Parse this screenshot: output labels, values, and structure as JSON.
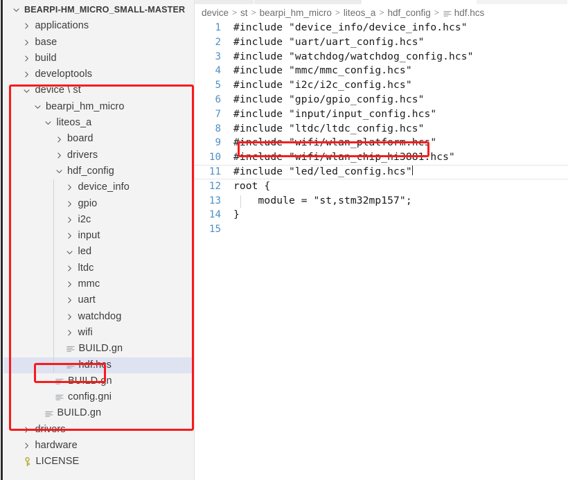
{
  "window": {
    "accent_red": "#f81b1b",
    "selection_bg": "#dfe2f1",
    "sidebar_bg": "#f3f3f3",
    "linenumber_color": "#4e8fc4"
  },
  "sidebar": {
    "root_label": "BEARPI-HM_MICRO_SMALL-MASTER",
    "items": [
      {
        "label": "BEARPI-HM_MICRO_SMALL-MASTER",
        "depth": 0,
        "kind": "folder",
        "state": "expanded",
        "root": true
      },
      {
        "label": "applications",
        "depth": 1,
        "kind": "folder",
        "state": "collapsed"
      },
      {
        "label": "base",
        "depth": 1,
        "kind": "folder",
        "state": "collapsed"
      },
      {
        "label": "build",
        "depth": 1,
        "kind": "folder",
        "state": "collapsed"
      },
      {
        "label": "developtools",
        "depth": 1,
        "kind": "folder",
        "state": "collapsed"
      },
      {
        "label": "device \\ st",
        "depth": 1,
        "kind": "folder",
        "state": "expanded"
      },
      {
        "label": "bearpi_hm_micro",
        "depth": 2,
        "kind": "folder",
        "state": "expanded"
      },
      {
        "label": "liteos_a",
        "depth": 3,
        "kind": "folder",
        "state": "expanded"
      },
      {
        "label": "board",
        "depth": 4,
        "kind": "folder",
        "state": "collapsed"
      },
      {
        "label": "drivers",
        "depth": 4,
        "kind": "folder",
        "state": "collapsed"
      },
      {
        "label": "hdf_config",
        "depth": 4,
        "kind": "folder",
        "state": "expanded"
      },
      {
        "label": "device_info",
        "depth": 5,
        "kind": "folder",
        "state": "collapsed"
      },
      {
        "label": "gpio",
        "depth": 5,
        "kind": "folder",
        "state": "collapsed"
      },
      {
        "label": "i2c",
        "depth": 5,
        "kind": "folder",
        "state": "collapsed"
      },
      {
        "label": "input",
        "depth": 5,
        "kind": "folder",
        "state": "collapsed"
      },
      {
        "label": "led",
        "depth": 5,
        "kind": "folder",
        "state": "expanded"
      },
      {
        "label": "ltdc",
        "depth": 5,
        "kind": "folder",
        "state": "collapsed"
      },
      {
        "label": "mmc",
        "depth": 5,
        "kind": "folder",
        "state": "collapsed"
      },
      {
        "label": "uart",
        "depth": 5,
        "kind": "folder",
        "state": "collapsed"
      },
      {
        "label": "watchdog",
        "depth": 5,
        "kind": "folder",
        "state": "collapsed"
      },
      {
        "label": "wifi",
        "depth": 5,
        "kind": "folder",
        "state": "collapsed"
      },
      {
        "label": "BUILD.gn",
        "depth": 5,
        "kind": "file",
        "icon": "config-file-icon"
      },
      {
        "label": "hdf.hcs",
        "depth": 5,
        "kind": "file",
        "icon": "config-file-icon",
        "selected": true
      },
      {
        "label": "BUILD.gn",
        "depth": 4,
        "kind": "file",
        "icon": "config-file-icon"
      },
      {
        "label": "config.gni",
        "depth": 4,
        "kind": "file",
        "icon": "config-file-icon"
      },
      {
        "label": "BUILD.gn",
        "depth": 3,
        "kind": "file",
        "icon": "config-file-icon"
      },
      {
        "label": "drivers",
        "depth": 1,
        "kind": "folder",
        "state": "collapsed"
      },
      {
        "label": "hardware",
        "depth": 1,
        "kind": "folder",
        "state": "collapsed"
      },
      {
        "label": "LICENSE",
        "depth": 1,
        "kind": "file",
        "icon": "key-icon"
      }
    ]
  },
  "breadcrumb": {
    "separator": ">",
    "crumbs": [
      "device",
      "st",
      "bearpi_hm_micro",
      "liteos_a",
      "hdf_config"
    ],
    "file": "hdf.hcs"
  },
  "editor": {
    "lines": [
      {
        "n": "1",
        "text": "#include \"device_info/device_info.hcs\""
      },
      {
        "n": "2",
        "text": "#include \"uart/uart_config.hcs\""
      },
      {
        "n": "3",
        "text": "#include \"watchdog/watchdog_config.hcs\""
      },
      {
        "n": "4",
        "text": "#include \"mmc/mmc_config.hcs\""
      },
      {
        "n": "5",
        "text": "#include \"i2c/i2c_config.hcs\""
      },
      {
        "n": "6",
        "text": "#include \"gpio/gpio_config.hcs\""
      },
      {
        "n": "7",
        "text": "#include \"input/input_config.hcs\""
      },
      {
        "n": "8",
        "text": "#include \"ltdc/ltdc_config.hcs\""
      },
      {
        "n": "9",
        "text": "#include \"wifi/wlan_platform.hcs\""
      },
      {
        "n": "10",
        "text": "#include \"wifi/wlan_chip_hi3881.hcs\""
      },
      {
        "n": "11",
        "text": "#include \"led/led_config.hcs\"",
        "current": true,
        "caret": true
      },
      {
        "n": "12",
        "text": "root {"
      },
      {
        "n": "13",
        "text": "    module = \"st,stm32mp157\";",
        "guide": true
      },
      {
        "n": "14",
        "text": "}"
      },
      {
        "n": "15",
        "text": ""
      }
    ]
  },
  "annotations": [
    {
      "name": "device-tree-highlight-box"
    },
    {
      "name": "hdf-hcs-file-highlight-box"
    },
    {
      "name": "led-include-line-highlight-box"
    }
  ]
}
